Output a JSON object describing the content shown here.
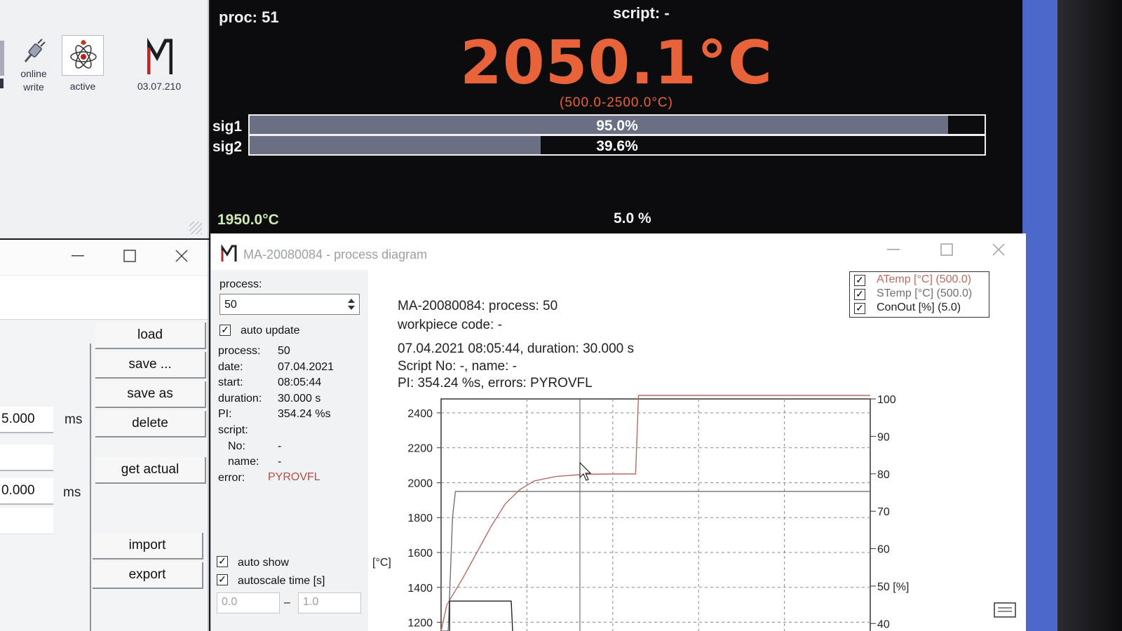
{
  "toolbar": {
    "items": [
      {
        "label_line1": "online",
        "label_line2": "write",
        "icon": "plug-icon"
      },
      {
        "label": "active",
        "icon": "atom-icon"
      },
      {
        "label": "03.07.210",
        "icon": "maurer-logo-icon"
      }
    ]
  },
  "display": {
    "proc": "proc: 51",
    "script": "script: -",
    "temperature": "2050.1°C",
    "range": "(500.0-2500.0°C)",
    "sig1": {
      "label": "sig1",
      "text": "95.0%",
      "level": 0.95
    },
    "sig2": {
      "label": "sig2",
      "text": "39.6%",
      "level": 0.396
    },
    "low_temp": "1950.0°C",
    "low_percent": "5.0 %",
    "temp_color": "#e8623a"
  },
  "settings_window": {
    "buttons": {
      "load": "load",
      "save": "save ...",
      "save_as": "save as",
      "delete": "delete",
      "get_actual": "get actual",
      "import": "import",
      "export": "export"
    },
    "field1_value": "5.000",
    "field2_value": "0.000",
    "unit": "ms"
  },
  "diagram_window": {
    "title": "MA-20080084 - process diagram",
    "process_label": "process:",
    "process_value": "50",
    "auto_update": "auto update",
    "details": {
      "process_label": "process:",
      "process": "50",
      "date_label": "date:",
      "date": "07.04.2021",
      "start_label": "start:",
      "start": "08:05:44",
      "duration_label": "duration:",
      "duration": "30.000 s",
      "pi_label": "PI:",
      "pi": "354.24 %s",
      "script_label": "script:",
      "no_label": "No:",
      "no": "-",
      "name_label": "name:",
      "name": "-",
      "error_label": "error:",
      "error": "PYROVFL"
    },
    "auto_show": "auto show",
    "autoscale": "autoscale time [s]",
    "time_from": "0.0",
    "time_dash": "–",
    "time_to": "1.0",
    "info": {
      "line1": "MA-20080084: process: 50",
      "line2": "workpiece code: -",
      "line3": "07.04.2021 08:05:44, duration: 30.000 s",
      "line4": "Script No: -, name: -",
      "line5": "PI: 354.24 %s, errors: PYROVFL"
    },
    "legend": [
      {
        "label": "ATemp [°C] (500.0)",
        "color": "#b56b5e"
      },
      {
        "label": "STemp [°C] (500.0)",
        "color": "#707070"
      },
      {
        "label": "ConOut [%] (5.0)",
        "color": "#222222"
      }
    ]
  },
  "chart_data": {
    "type": "line",
    "ylabel": "[°C]",
    "y2label": "50 [%]",
    "left_ticks": [
      "2400",
      "2200",
      "2000",
      "1800",
      "1600",
      "1400",
      "1200"
    ],
    "right_ticks": [
      "100",
      "90",
      "80",
      "70",
      "60",
      "40"
    ],
    "ylim": [
      1150,
      2480
    ],
    "y2lim": [
      38,
      100
    ],
    "xlim": [
      0,
      30
    ],
    "grid": true,
    "series": [
      {
        "name": "ATemp [°C] (500.0)",
        "color": "#b56b5e",
        "points": [
          [
            0,
            1150
          ],
          [
            0.4,
            1300
          ],
          [
            1.5,
            1450
          ],
          [
            2.5,
            1600
          ],
          [
            3.5,
            1750
          ],
          [
            4.5,
            1880
          ],
          [
            5.5,
            1960
          ],
          [
            6.5,
            2010
          ],
          [
            8,
            2035
          ],
          [
            10,
            2048
          ],
          [
            12,
            2050
          ],
          [
            13.6,
            2050
          ],
          [
            13.8,
            2500
          ],
          [
            30,
            2500
          ]
        ]
      },
      {
        "name": "STemp [°C] (500.0)",
        "color": "#707070",
        "points": [
          [
            0,
            1150
          ],
          [
            0.5,
            1150
          ],
          [
            0.8,
            1800
          ],
          [
            1.0,
            1950
          ],
          [
            30,
            1950
          ]
        ]
      },
      {
        "name": "ConOut [%] (5.0)",
        "color": "#222222",
        "points": [
          [
            0.6,
            38
          ],
          [
            0.6,
            46
          ],
          [
            4.9,
            46
          ],
          [
            5.0,
            38
          ]
        ]
      }
    ]
  }
}
